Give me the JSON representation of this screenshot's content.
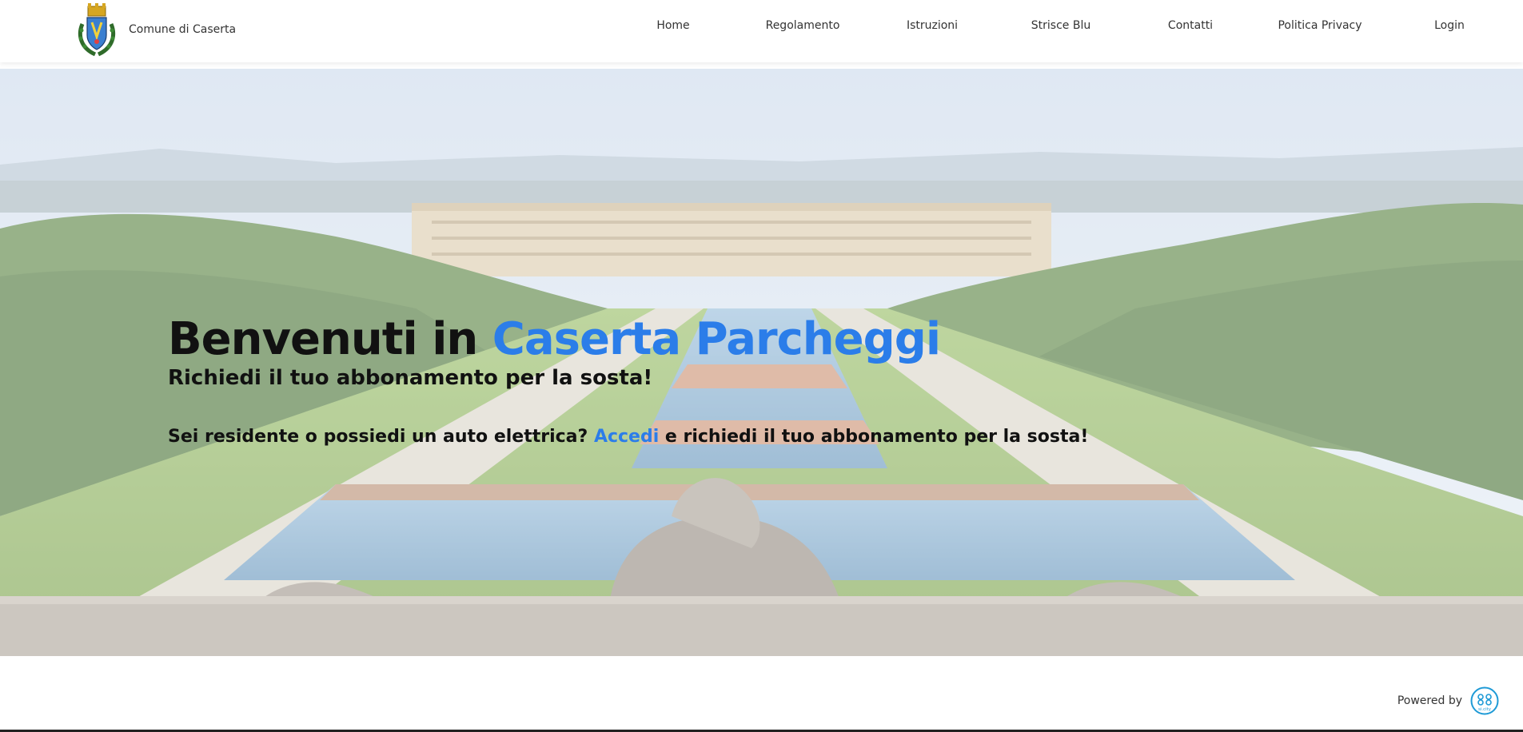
{
  "header": {
    "brand_name": "Comune di Caserta",
    "nav": [
      {
        "label": "Home"
      },
      {
        "label": "Regolamento"
      },
      {
        "label": "Istruzioni"
      },
      {
        "label": "Strisce Blu"
      },
      {
        "label": "Contatti"
      },
      {
        "label": "Politica Privacy"
      },
      {
        "label": "Login"
      }
    ]
  },
  "hero": {
    "title_prefix": "Benvenuti in ",
    "title_accent": "Caserta Parcheggi",
    "subtitle": "Richiedi il tuo abbonamento per la sosta!",
    "cta_prefix": "Sei residente o possiedi un auto elettrica? ",
    "cta_link": "Accedi",
    "cta_suffix": " e richiedi il tuo abbonamento per la sosta!"
  },
  "footer": {
    "powered_by": "Powered by",
    "logo_text": "si.city"
  },
  "colors": {
    "accent": "#2b7de9",
    "text": "#111111"
  },
  "icons": {
    "crest": "comune-caserta-crest-icon",
    "powered_logo": "sicity-logo-icon"
  }
}
